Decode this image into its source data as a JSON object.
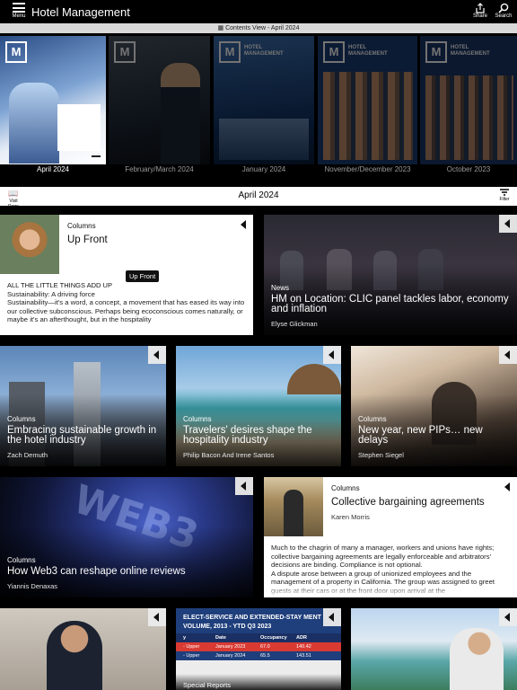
{
  "app": {
    "title": "Hotel Management",
    "menu_label": "Menu",
    "share_label": "Share",
    "search_label": "Search"
  },
  "contents_view": "Contents View - April 2024",
  "issues": [
    {
      "label": "April 2024",
      "selected": true
    },
    {
      "label": "February/March 2024",
      "selected": false
    },
    {
      "label": "January 2024",
      "selected": false
    },
    {
      "label": "November/December 2023",
      "selected": false
    },
    {
      "label": "October 2023",
      "selected": false
    }
  ],
  "section": {
    "visit_label": "Visit Page",
    "title": "April 2024",
    "filter_label": "Filter"
  },
  "articles": {
    "up_front": {
      "category": "Columns",
      "title": "Up Front",
      "tag": "Up Front",
      "kicker": "ALL THE LITTLE THINGS ADD UP",
      "subhead": "Sustainability: A driving force",
      "body": "Sustainability—it's a word, a concept, a movement that has eased its way into our collective subconscious. Perhaps being ecoconscious comes naturally, or maybe it's an afterthought, but in the hospitality"
    },
    "clic": {
      "category": "News",
      "title": "HM on Location: CLIC panel tackles labor, economy and inflation",
      "author": "Elyse Glickman"
    },
    "sustainable": {
      "category": "Columns",
      "title": "Embracing sustainable growth in the hotel industry",
      "author": "Zach Demuth"
    },
    "travelers": {
      "category": "Columns",
      "title": "Travelers' desires shape the hospitality industry",
      "author": "Philip Bacon And Irene Santos"
    },
    "pips": {
      "category": "Columns",
      "title": "New year, new PIPs… new delays",
      "author": "Stephen Siegel"
    },
    "web3": {
      "category": "Columns",
      "title": "How Web3 can reshape online reviews",
      "author": "Yiannis Denaxas"
    },
    "bargaining": {
      "category": "Columns",
      "title": "Collective bargaining agreements",
      "author": "Karen Morris",
      "body1": "Much to the chagrin of many a manager, workers and unions have rights; collective bargaining agreements are legally enforceable and arbitrators' decisions are binding. Compliance is not optional.",
      "body2": "A dispute arose between a group of unionized employees and the management of a property in California. The group was assigned to greet guests at their cars or at the front door upon arrival at the"
    },
    "report": {
      "heading": "ELECT-SERVICE AND EXTENDED-STAY MENT VOLUME, 2013 - YTD Q3 2023",
      "columns": [
        "y",
        "Date",
        "Occupancy",
        "ADR"
      ],
      "rows": [
        [
          "- Upper",
          "January 2023",
          "67.0",
          "140.42"
        ],
        [
          "- Upper",
          "January 2024",
          "65.5",
          "143.51"
        ]
      ],
      "category": "Special Reports"
    }
  }
}
